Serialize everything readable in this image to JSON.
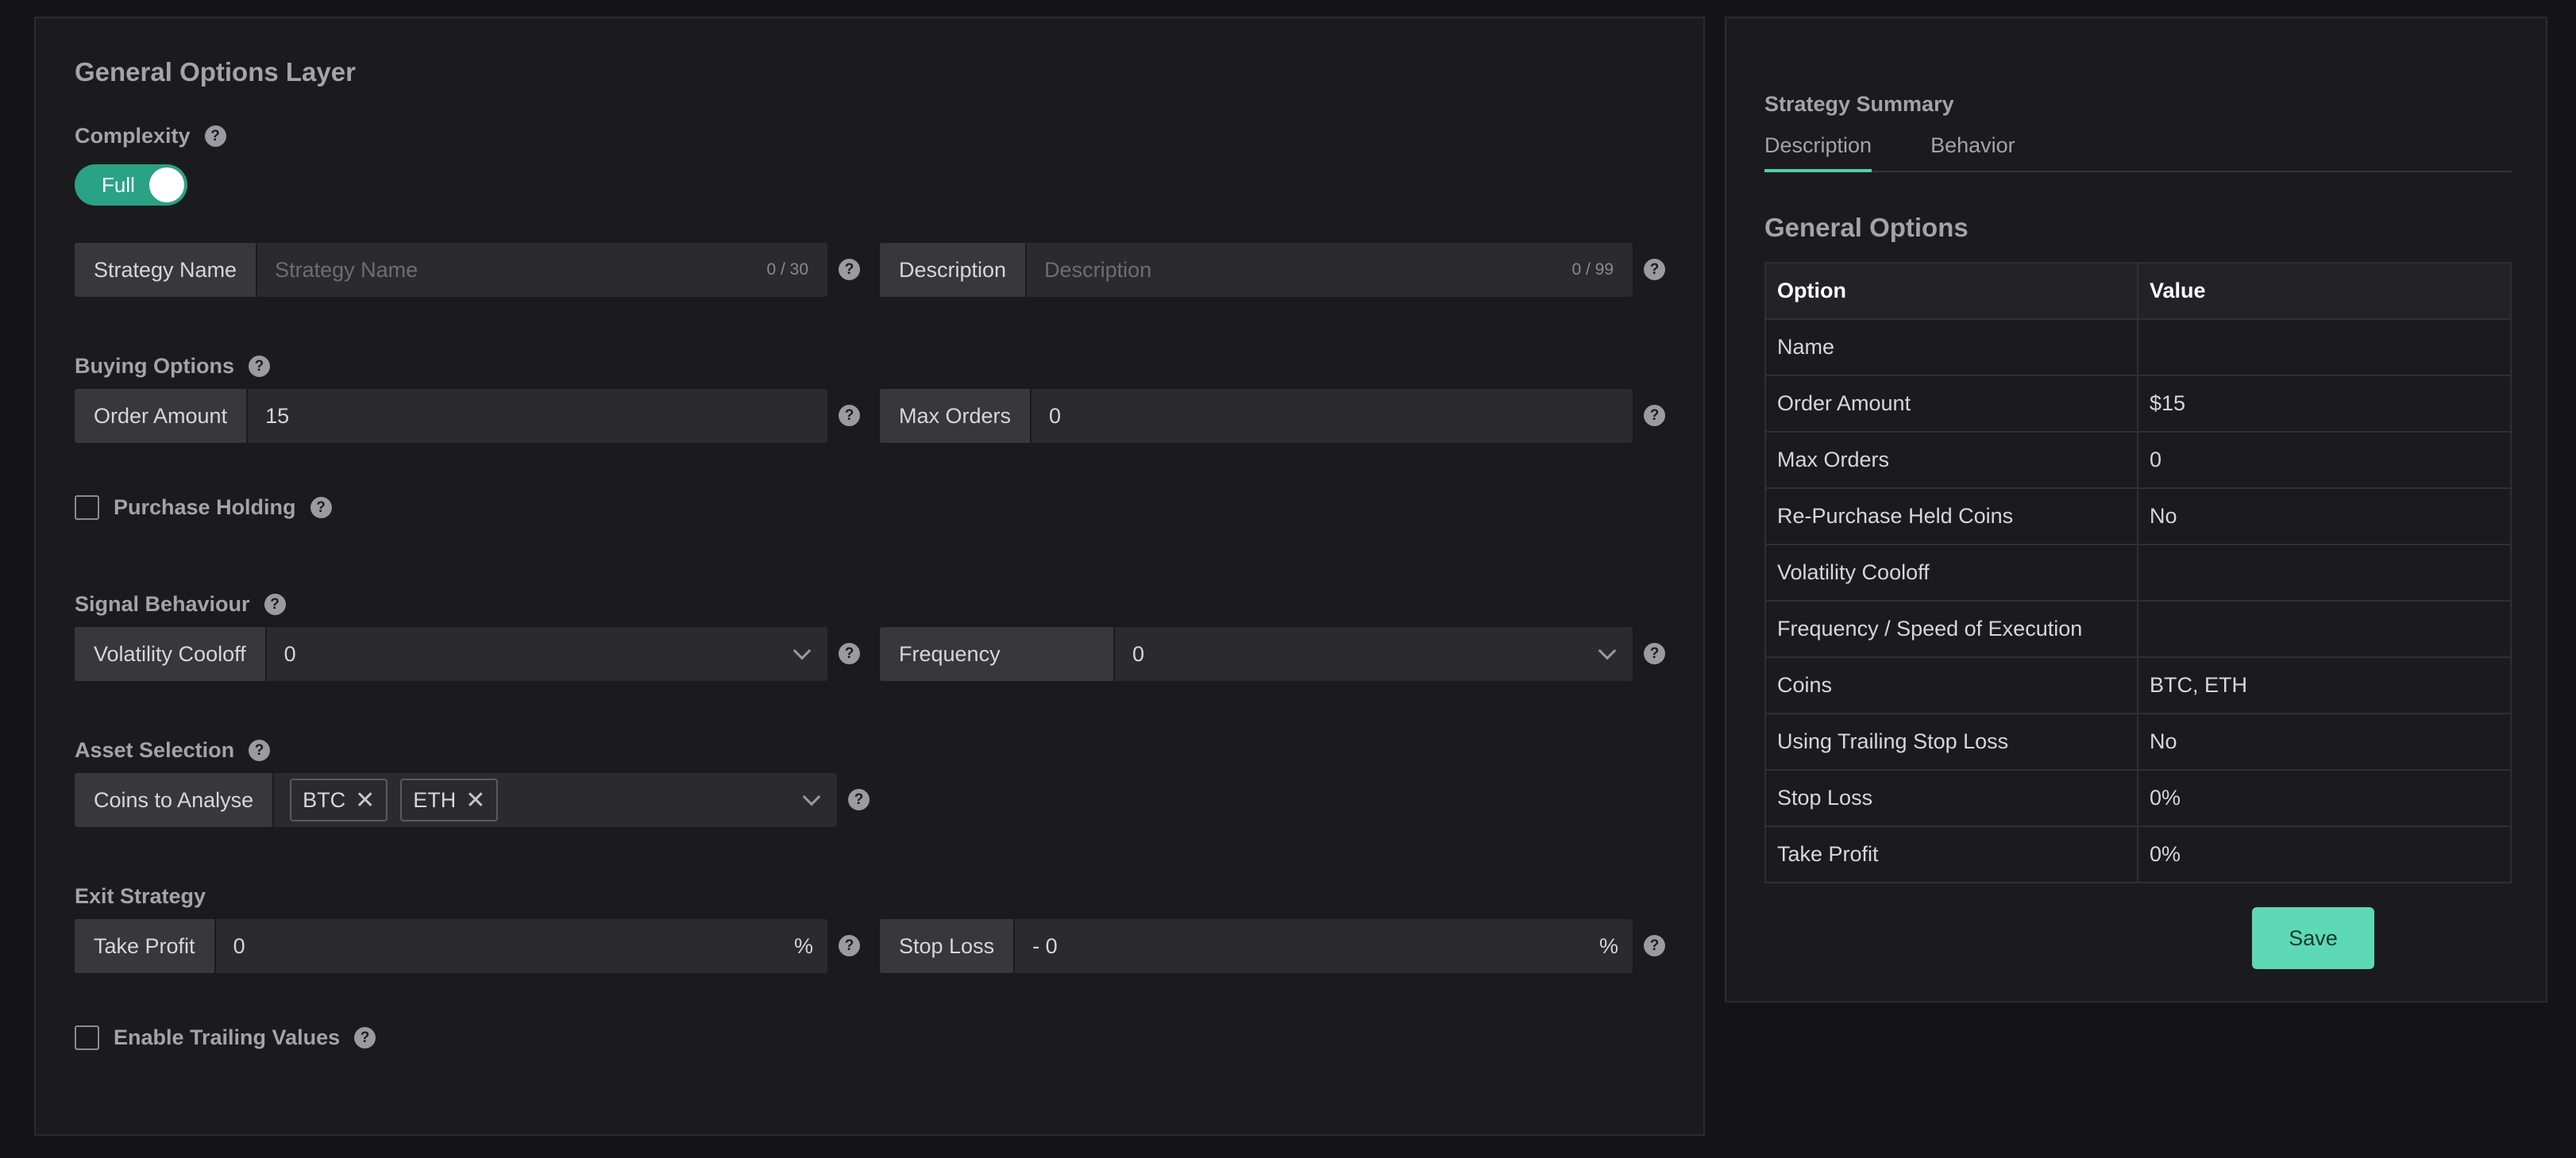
{
  "general": {
    "title": "General Options Layer",
    "complexity_label": "Complexity",
    "complexity_toggle": "Full"
  },
  "help_glyph": "?",
  "strategy_name": {
    "label": "Strategy Name",
    "placeholder": "Strategy Name",
    "counter": "0 / 30"
  },
  "description": {
    "label": "Description",
    "placeholder": "Description",
    "counter": "0 / 99"
  },
  "buying": {
    "title": "Buying Options",
    "order_amount_label": "Order Amount",
    "order_amount_value": "15",
    "max_orders_label": "Max Orders",
    "max_orders_value": "0"
  },
  "purchase_holding": {
    "label": "Purchase Holding",
    "checked": false
  },
  "signal": {
    "title": "Signal Behaviour",
    "volatility_label": "Volatility Cooloff",
    "volatility_value": "0",
    "frequency_label": "Frequency",
    "frequency_value": "0"
  },
  "assets": {
    "title": "Asset Selection",
    "coins_label": "Coins to Analyse",
    "coins": [
      "BTC",
      "ETH"
    ]
  },
  "exit": {
    "title": "Exit Strategy",
    "take_profit_label": "Take Profit",
    "take_profit_value": "0",
    "take_profit_suffix": "%",
    "stop_loss_label": "Stop Loss",
    "stop_loss_value": "- 0",
    "stop_loss_suffix": "%"
  },
  "trailing": {
    "label": "Enable Trailing Values",
    "checked": false
  },
  "summary": {
    "title": "Strategy Summary",
    "tabs": [
      "Description",
      "Behavior"
    ],
    "active_tab": "Description",
    "section_title": "General Options",
    "header": [
      "Option",
      "Value"
    ],
    "rows": [
      [
        "Name",
        ""
      ],
      [
        "Order Amount",
        "$15"
      ],
      [
        "Max Orders",
        "0"
      ],
      [
        "Re-Purchase Held Coins",
        "No"
      ],
      [
        "Volatility Cooloff",
        ""
      ],
      [
        "Frequency / Speed of Execution",
        ""
      ],
      [
        "Coins",
        "BTC, ETH"
      ],
      [
        "Using Trailing Stop Loss",
        "No"
      ],
      [
        "Stop Loss",
        "0%"
      ],
      [
        "Take Profit",
        "0%"
      ]
    ],
    "save_label": "Save"
  },
  "colors": {
    "background": "#141416",
    "panel": "#1b1b1e",
    "accent": "#29a285",
    "save": "#5ed9b5"
  }
}
